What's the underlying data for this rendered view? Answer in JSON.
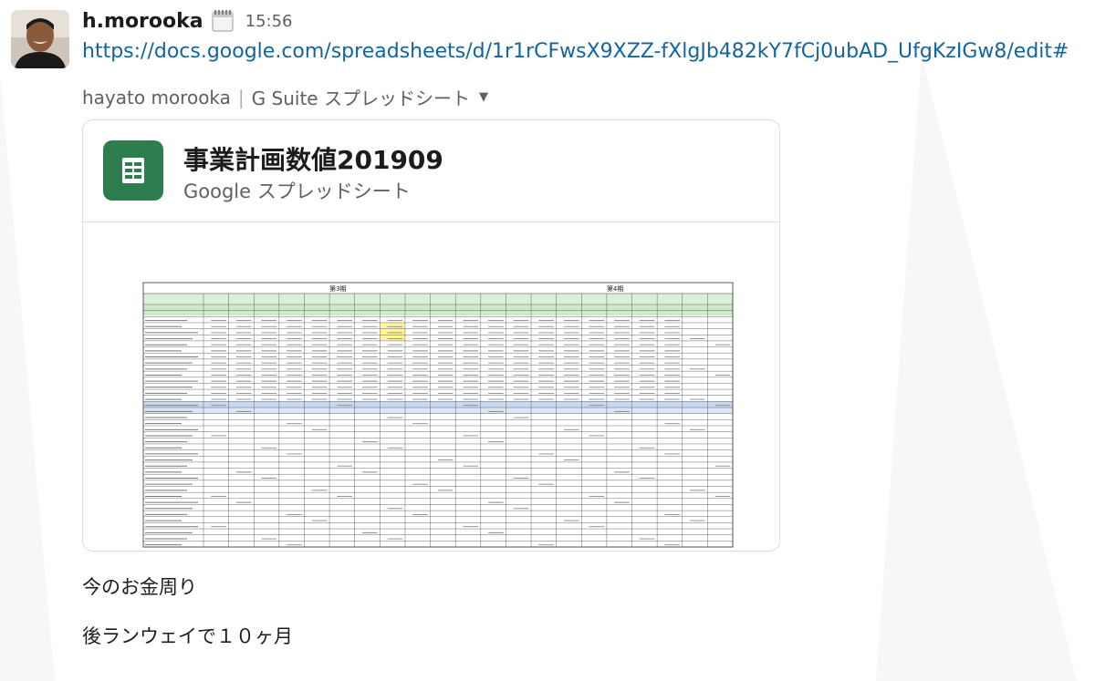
{
  "message": {
    "username": "h.morooka",
    "status_emoji": "calendar-icon",
    "time": "15:56",
    "link": "https://docs.google.com/spreadsheets/d/1r1rCFwsX9XZZ-fXlgJb482kY7fCj0ubAD_UfgKzIGw8/edit#",
    "attribution_author": "hayato morooka",
    "attribution_sep": "|",
    "attribution_app": "G Suite スプレッドシート",
    "lines": [
      "今のお金周り",
      "後ランウェイで１０ヶ月"
    ]
  },
  "card": {
    "title": "事業計画数値201909",
    "subtitle": "Google スプレッドシート",
    "preview_period_labels": [
      "第3期",
      "第4期"
    ]
  },
  "colors": {
    "link": "#1264a3",
    "sheets_green": "#2e7d4f",
    "muted": "#616061"
  }
}
